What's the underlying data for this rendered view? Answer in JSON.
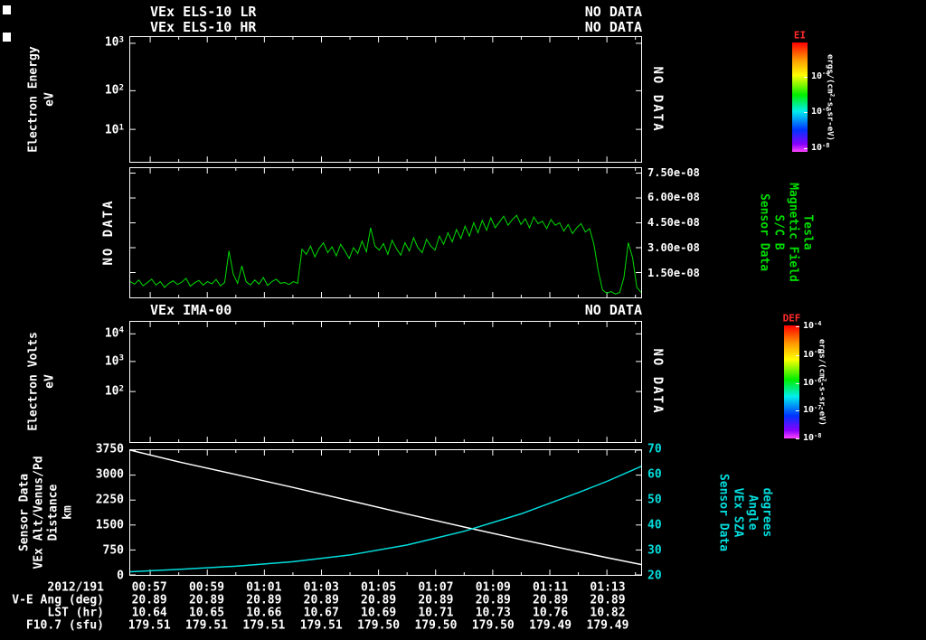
{
  "colors": {
    "background": "#000000",
    "foreground": "#ffffff",
    "trace_green": "#00dd00",
    "trace_cyan": "#00dddd",
    "trace_white": "#ffffff",
    "colorbar_label_red": "#ff2a2a"
  },
  "header": {
    "row1": {
      "title": "VEx ELS-10 LR",
      "status": "NO DATA"
    },
    "row2": {
      "title": "VEx ELS-10 HR",
      "status": "NO DATA"
    },
    "row3": {
      "title": "VEx IMA-00",
      "status": "NO DATA"
    }
  },
  "panel1": {
    "ylabel": "Electron Energy",
    "yunit": "eV",
    "yticks": [
      {
        "frac": 0.05,
        "label": "10^3"
      },
      {
        "frac": 0.43,
        "label": "10^2"
      },
      {
        "frac": 0.74,
        "label": "10^1"
      }
    ],
    "right_note": "NO DATA"
  },
  "panel2": {
    "left_note": "NO DATA",
    "yticks": [
      {
        "value": 7.5,
        "label": "7.50e-08"
      },
      {
        "value": 6.0,
        "label": "6.00e-08"
      },
      {
        "value": 4.5,
        "label": "4.50e-08"
      },
      {
        "value": 3.0,
        "label": "3.00e-08"
      },
      {
        "value": 1.5,
        "label": "1.50e-08"
      }
    ],
    "right_labels": [
      "Sensor Data",
      "S/C B",
      "Magnetic Field",
      "Tesla"
    ]
  },
  "panel3": {
    "ylabel": "Electron Volts",
    "yunit": "eV",
    "yticks": [
      {
        "frac": 0.1,
        "label": "10^4"
      },
      {
        "frac": 0.33,
        "label": "10^3"
      },
      {
        "frac": 0.58,
        "label": "10^2"
      }
    ],
    "right_note": "NO DATA"
  },
  "panel4": {
    "left_labels": [
      "Sensor Data",
      "VEx Alt/Venus/Pd",
      "Distance",
      "km"
    ],
    "right_labels": [
      "Sensor Data",
      "VEx SZA",
      "Angle",
      "degrees"
    ],
    "yticks_left": [
      "3750",
      "3000",
      "2250",
      "1500",
      "750",
      "0"
    ],
    "yticks_right": [
      "70",
      "60",
      "50",
      "40",
      "30",
      "20"
    ]
  },
  "colorbar1": {
    "label": "EI",
    "unit": "ergs/(cm^2-s-sr-eV)",
    "ticks": [
      {
        "frac": 0.31,
        "label": "10^-4"
      },
      {
        "frac": 0.64,
        "label": "10^-6"
      },
      {
        "frac": 0.97,
        "label": "10^-8"
      }
    ]
  },
  "colorbar2": {
    "label": "DEF",
    "unit": "ergs/(cm^2-s-sr-eV)",
    "ticks": [
      {
        "frac": 0.01,
        "label": "10^-4"
      },
      {
        "frac": 0.26,
        "label": "10^-5"
      },
      {
        "frac": 0.51,
        "label": "10^-6"
      },
      {
        "frac": 0.755,
        "label": "10^-7"
      },
      {
        "frac": 1.0,
        "label": "10^-8"
      }
    ]
  },
  "xaxis": {
    "ticks": [
      {
        "t": 57,
        "label": "00:57"
      },
      {
        "t": 59,
        "label": "00:59"
      },
      {
        "t": 61,
        "label": "01:01"
      },
      {
        "t": 63,
        "label": "01:03"
      },
      {
        "t": 65,
        "label": "01:05"
      },
      {
        "t": 67,
        "label": "01:07"
      },
      {
        "t": 69,
        "label": "01:09"
      },
      {
        "t": 71,
        "label": "01:11"
      },
      {
        "t": 73,
        "label": "01:13"
      }
    ]
  },
  "bottom_table": {
    "date": "2012/191",
    "rows": [
      {
        "label": "V-E Ang (deg)",
        "values": [
          "20.89",
          "20.89",
          "20.89",
          "20.89",
          "20.89",
          "20.89",
          "20.89",
          "20.89",
          "20.89"
        ]
      },
      {
        "label": "LST (hr)",
        "values": [
          "10.64",
          "10.65",
          "10.66",
          "10.67",
          "10.69",
          "10.71",
          "10.73",
          "10.76",
          "10.82"
        ]
      },
      {
        "label": "F10.7 (sfu)",
        "values": [
          "179.51",
          "179.51",
          "179.51",
          "179.51",
          "179.50",
          "179.50",
          "179.50",
          "179.49",
          "179.49"
        ]
      }
    ]
  },
  "chart_data": [
    {
      "id": "els_spectrogram",
      "type": "heatmap",
      "title": "VEx ELS-10 LR / VEx ELS-10 HR",
      "status": "NO DATA",
      "ylabel": "Electron Energy (eV)",
      "yscale": "log",
      "ytick_labels": [
        "10^1",
        "10^2",
        "10^3"
      ],
      "data": "none"
    },
    {
      "id": "magnetic_field",
      "type": "line",
      "title": "Sensor Data S/C B Magnetic Field",
      "ylabel": "Tesla",
      "ylim": [
        0,
        7.8e-08
      ],
      "ytick_labels": [
        "1.50e-08",
        "3.00e-08",
        "4.50e-08",
        "6.00e-08",
        "7.50e-08"
      ],
      "x_start_min": 56.3,
      "x_end_min": 74.2,
      "x_unit": "minutes after 00:00 UT on 2012/191",
      "series": [
        {
          "name": "S/C B magnetic field magnitude",
          "color": "#00dd00",
          "value_unit": "1e-8 Tesla",
          "values_1e8_tesla": [
            0.95,
            0.8,
            1.05,
            0.7,
            0.9,
            1.1,
            0.75,
            0.95,
            0.6,
            0.85,
            1.0,
            0.78,
            0.92,
            1.15,
            0.68,
            0.88,
            1.02,
            0.74,
            0.96,
            0.82,
            1.08,
            0.7,
            0.9,
            2.8,
            1.4,
            0.85,
            1.9,
            0.95,
            0.75,
            1.05,
            0.8,
            1.2,
            0.72,
            0.95,
            1.1,
            0.85,
            0.9,
            0.78,
            0.95,
            0.85,
            2.9,
            2.6,
            3.1,
            2.45,
            2.95,
            3.3,
            2.7,
            3.05,
            2.5,
            3.2,
            2.8,
            2.35,
            3.0,
            2.65,
            3.4,
            2.75,
            4.2,
            3.1,
            2.85,
            3.25,
            2.6,
            3.45,
            2.95,
            2.55,
            3.3,
            2.8,
            3.6,
            3.0,
            2.7,
            3.5,
            3.1,
            2.85,
            3.7,
            3.2,
            3.9,
            3.35,
            4.1,
            3.55,
            4.3,
            3.7,
            4.5,
            3.9,
            4.65,
            4.05,
            4.8,
            4.2,
            4.55,
            4.9,
            4.35,
            4.7,
            4.95,
            4.4,
            4.75,
            4.2,
            4.85,
            4.45,
            4.6,
            4.15,
            4.7,
            4.35,
            4.5,
            4.0,
            4.4,
            3.85,
            4.2,
            4.45,
            3.95,
            4.15,
            3.2,
            1.6,
            0.45,
            0.25,
            0.35,
            0.2,
            0.3,
            1.2,
            3.3,
            2.4,
            0.6,
            0.3
          ]
        }
      ]
    },
    {
      "id": "ima_spectrogram",
      "type": "heatmap",
      "title": "VEx IMA-00",
      "status": "NO DATA",
      "ylabel": "Electron Volts (eV)",
      "yscale": "log",
      "ytick_labels": [
        "10^2",
        "10^3",
        "10^4"
      ],
      "data": "none"
    },
    {
      "id": "trajectory",
      "type": "line",
      "x_tick_labels": [
        "00:57",
        "00:59",
        "01:01",
        "01:03",
        "01:05",
        "01:07",
        "01:09",
        "01:11",
        "01:13"
      ],
      "series": [
        {
          "name": "VEx Alt/Venus/Pd Distance",
          "unit": "km",
          "color": "#ffffff",
          "ylim": [
            0,
            3750
          ],
          "points_t_min_value": [
            [
              56.3,
              3750
            ],
            [
              58,
              3400
            ],
            [
              60,
              3020
            ],
            [
              62,
              2630
            ],
            [
              64,
              2230
            ],
            [
              66,
              1830
            ],
            [
              68,
              1440
            ],
            [
              70,
              1060
            ],
            [
              72,
              700
            ],
            [
              73,
              520
            ],
            [
              74.2,
              310
            ]
          ]
        },
        {
          "name": "VEx SZA Angle",
          "unit": "degrees",
          "color": "#00dddd",
          "ylim": [
            20,
            70
          ],
          "points_t_min_value": [
            [
              56.3,
              21.3
            ],
            [
              58,
              22.2
            ],
            [
              60,
              23.5
            ],
            [
              62,
              25.3
            ],
            [
              64,
              28.0
            ],
            [
              66,
              32.0
            ],
            [
              68,
              37.5
            ],
            [
              70,
              44.5
            ],
            [
              72,
              53.0
            ],
            [
              73,
              57.5
            ],
            [
              74.2,
              63.5
            ]
          ]
        }
      ]
    }
  ]
}
